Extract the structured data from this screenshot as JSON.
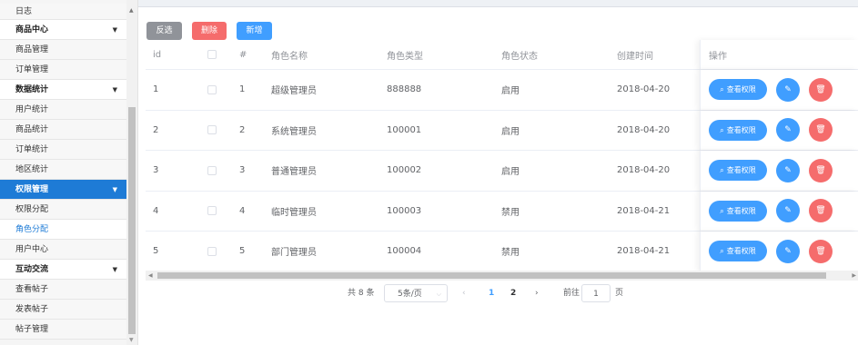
{
  "sidebar": {
    "items": [
      {
        "label": "日志",
        "kind": "sub"
      },
      {
        "label": "商品中心",
        "kind": "group"
      },
      {
        "label": "商品管理",
        "kind": "sub"
      },
      {
        "label": "订单管理",
        "kind": "sub"
      },
      {
        "label": "数据统计",
        "kind": "group"
      },
      {
        "label": "用户统计",
        "kind": "sub"
      },
      {
        "label": "商品统计",
        "kind": "sub"
      },
      {
        "label": "订单统计",
        "kind": "sub"
      },
      {
        "label": "地区统计",
        "kind": "sub"
      },
      {
        "label": "权限管理",
        "kind": "group-active"
      },
      {
        "label": "权限分配",
        "kind": "sub"
      },
      {
        "label": "角色分配",
        "kind": "sub-current"
      },
      {
        "label": "用户中心",
        "kind": "sub"
      },
      {
        "label": "互动交流",
        "kind": "group"
      },
      {
        "label": "查看帖子",
        "kind": "sub"
      },
      {
        "label": "发表帖子",
        "kind": "sub"
      },
      {
        "label": "帖子管理",
        "kind": "sub"
      }
    ],
    "arrow_icon": "▼"
  },
  "toolbar": {
    "invert_label": "反选",
    "delete_label": "删除",
    "add_label": "新增"
  },
  "table": {
    "headers": {
      "id": "id",
      "index": "#",
      "name": "角色名称",
      "type": "角色类型",
      "status": "角色状态",
      "created": "创建时间",
      "ops": "操作"
    },
    "rows": [
      {
        "id": "1",
        "index": "1",
        "name": "超级管理员",
        "type": "888888",
        "status": "启用",
        "created": "2018-04-20"
      },
      {
        "id": "2",
        "index": "2",
        "name": "系统管理员",
        "type": "100001",
        "status": "启用",
        "created": "2018-04-20"
      },
      {
        "id": "3",
        "index": "3",
        "name": "普通管理员",
        "type": "100002",
        "status": "启用",
        "created": "2018-04-20"
      },
      {
        "id": "4",
        "index": "4",
        "name": "临时管理员",
        "type": "100003",
        "status": "禁用",
        "created": "2018-04-21"
      },
      {
        "id": "5",
        "index": "5",
        "name": "部门管理员",
        "type": "100004",
        "status": "禁用",
        "created": "2018-04-21"
      }
    ],
    "view_perm_label": "查看权限",
    "search_icon": "⌕",
    "edit_icon": "✎",
    "delete_icon": "🗑"
  },
  "pagination": {
    "total": "共 8 条",
    "page_size": "5条/页",
    "prev": "‹",
    "page1": "1",
    "page2": "2",
    "next": "›",
    "goto": "前往",
    "goto_value": "1",
    "unit": "页"
  },
  "colors": {
    "primary": "#409eff",
    "danger": "#f56c6c",
    "info": "#909399",
    "sidebar_active": "#1e7bd6"
  }
}
